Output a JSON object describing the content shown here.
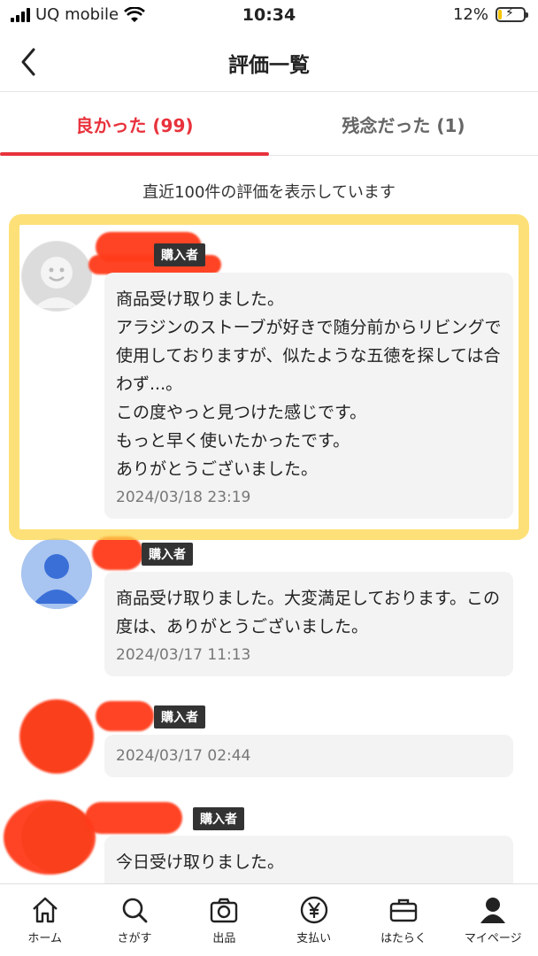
{
  "status_bar": {
    "carrier": "UQ mobile",
    "time": "10:34",
    "battery_pct": "12%",
    "battery_level": 0.12,
    "icons": [
      "signal-icon",
      "wifi-icon",
      "battery-icon"
    ]
  },
  "header": {
    "title": "評価一覧",
    "back_icon": "chevron-left-icon"
  },
  "tabs": [
    {
      "label": "良かった (99)",
      "active": true
    },
    {
      "label": "残念だった (1)",
      "active": false
    }
  ],
  "notice": "直近100件の評価を表示しています",
  "reviews": [
    {
      "badge": "購入者",
      "text": "商品受け取りました。\nアラジンのストーブが好きで随分前からリビングで使用しておりますが、似たような五徳を探しては合わず...。\nこの度やっと見つけた感じです。\nもっと早く使いたかったです。\nありがとうございました。",
      "date": "2024/03/18 23:19"
    },
    {
      "badge": "購入者",
      "text": "商品受け取りました。大変満足しております。この度は、ありがとうございました。",
      "date": "2024/03/17 11:13"
    },
    {
      "badge": "購入者",
      "text": "",
      "date": "2024/03/17 02:44"
    },
    {
      "badge": "購入者",
      "text": "今日受け取りました。",
      "date": ""
    }
  ],
  "bottom_nav": [
    {
      "label": "ホーム",
      "icon": "home-icon"
    },
    {
      "label": "さがす",
      "icon": "search-icon"
    },
    {
      "label": "出品",
      "icon": "camera-icon"
    },
    {
      "label": "支払い",
      "icon": "yen-icon"
    },
    {
      "label": "はたらく",
      "icon": "briefcase-icon"
    },
    {
      "label": "マイページ",
      "icon": "person-icon"
    }
  ],
  "colors": {
    "accent": "#e8323c",
    "highlight": "#fcd54a",
    "redaction": "#ff3b1a"
  }
}
